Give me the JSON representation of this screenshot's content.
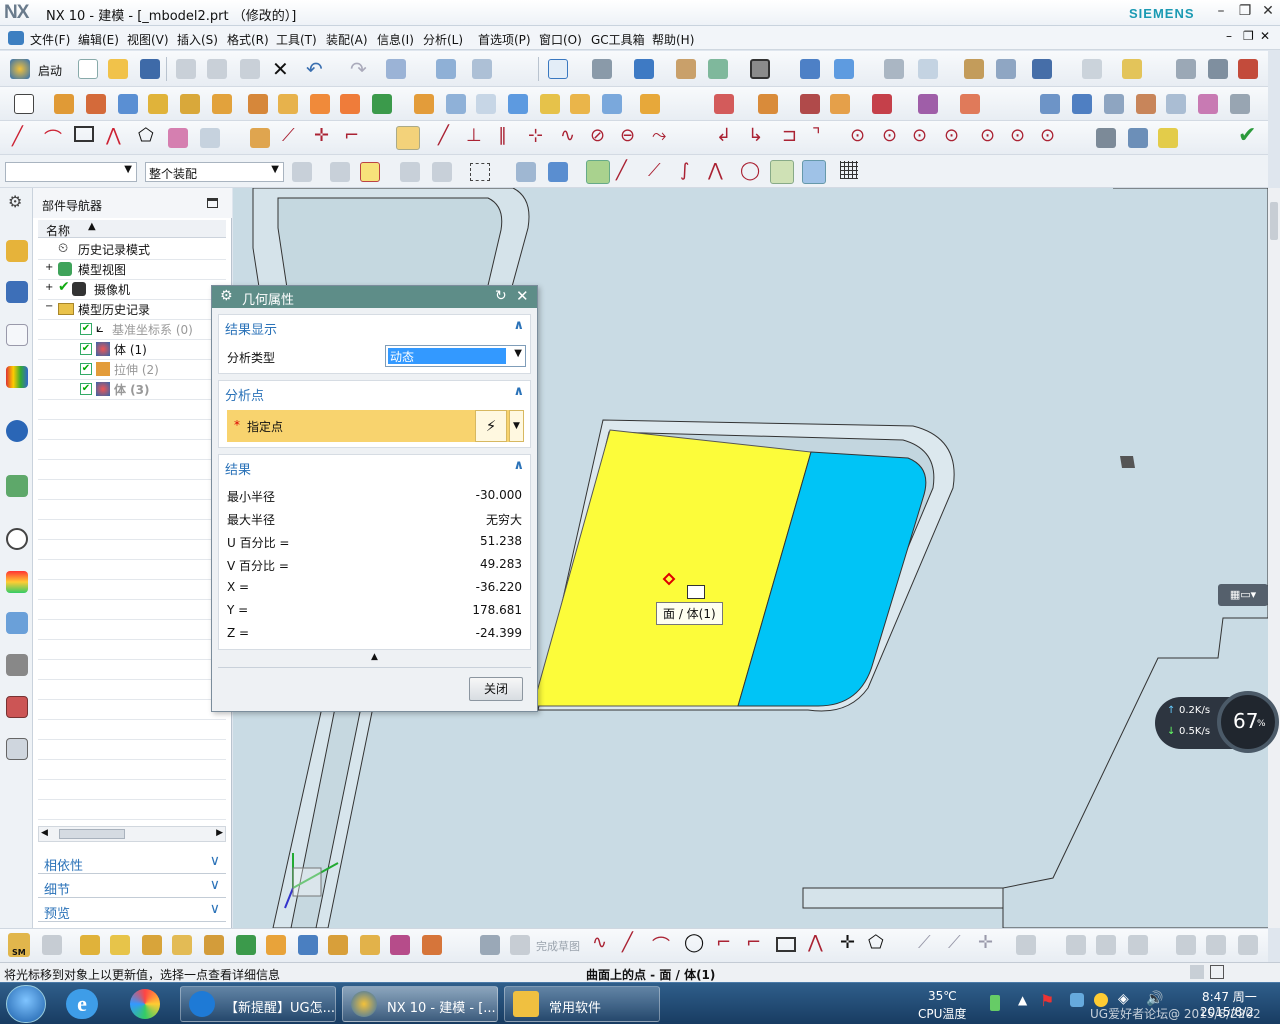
{
  "window": {
    "logo": "NX",
    "title": "NX 10 - 建模 - [_mbodel2.prt （修改的）]",
    "brand": "SIEMENS"
  },
  "menubar": {
    "items": [
      "文件(F)",
      "编辑(E)",
      "视图(V)",
      "插入(S)",
      "格式(R)",
      "工具(T)",
      "装配(A)",
      "信息(I)",
      "分析(L)",
      "首选项(P)",
      "窗口(O)",
      "GC工具箱",
      "帮助(H)"
    ]
  },
  "toolbar": {
    "start_label": "启动",
    "filter_value": "",
    "assembly_scope": "整个装配"
  },
  "navigator": {
    "title": "部件导航器",
    "column_header": "名称",
    "items": [
      {
        "label": "历史记录模式"
      },
      {
        "label": "模型视图"
      },
      {
        "label": "摄像机"
      },
      {
        "label": "模型历史记录"
      },
      {
        "label": "基准坐标系 (0)"
      },
      {
        "label": "体 (1)"
      },
      {
        "label": "拉伸 (2)"
      },
      {
        "label": "体 (3)"
      }
    ],
    "accordions": [
      "相依性",
      "细节",
      "预览"
    ]
  },
  "dialog": {
    "title": "几何属性",
    "sections": {
      "display": {
        "title": "结果显示",
        "analysis_type_label": "分析类型",
        "analysis_type_value": "动态"
      },
      "point": {
        "title": "分析点",
        "specify_label": "指定点"
      },
      "results": {
        "title": "结果",
        "rows": [
          {
            "label": "最小半径",
            "value": "-30.000"
          },
          {
            "label": "最大半径",
            "value": "无穷大"
          },
          {
            "label": "U 百分比 =",
            "value": "51.238"
          },
          {
            "label": "V 百分比 =",
            "value": "49.283"
          },
          {
            "label": "X =",
            "value": "-36.220"
          },
          {
            "label": "Y =",
            "value": "178.681"
          },
          {
            "label": "Z =",
            "value": "-24.399"
          }
        ]
      }
    },
    "close_label": "关闭"
  },
  "viewport": {
    "tooltip": "面 / 体(1)"
  },
  "bottom_toolbar": {
    "finish_sketch": "完成草图",
    "sm_label": "SM"
  },
  "status": {
    "left": "将光标移到对象上以更新值，选择一点查看详细信息",
    "center": "曲面上的点 - 面 / 体(1)"
  },
  "network": {
    "up": "0.2K/s",
    "down": "0.5K/s",
    "cpu_percent": "67",
    "cpu_unit": "%"
  },
  "taskbar": {
    "items": [
      {
        "label": "【新提醒】UG怎..."
      },
      {
        "label": "NX 10 - 建模 - [..."
      },
      {
        "label": "常用软件"
      }
    ],
    "temperature": "35℃",
    "temp_label": "CPU温度",
    "time": "8:47 周一",
    "date": "2015/8/2",
    "watermark": "UG爱好者论坛@ 2015/8/2202"
  },
  "colors": {
    "accent": "#2a72b8",
    "dialog_header": "#5e8d88",
    "face_yellow": "#fcfc3a",
    "face_cyan": "#00c4f6",
    "viewport_bg": "#c9dbe4",
    "specify_bg": "#f8d36e"
  }
}
